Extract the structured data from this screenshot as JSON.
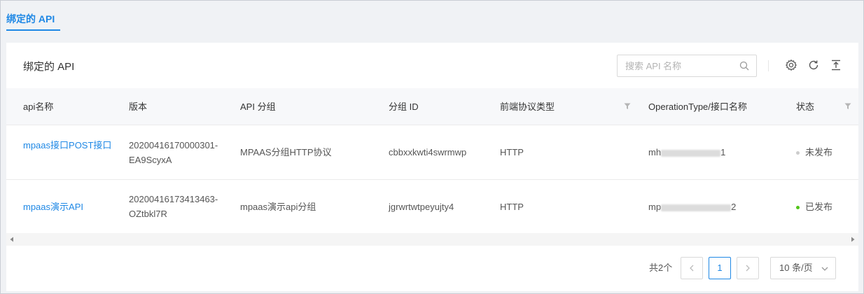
{
  "tab": {
    "label": "绑定的 API"
  },
  "card": {
    "title": "绑定的 API"
  },
  "search": {
    "placeholder": "搜索 API 名称",
    "value": ""
  },
  "toolbar": {
    "icons": [
      "settings-icon",
      "refresh-icon",
      "export-icon"
    ]
  },
  "table": {
    "columns": [
      "api名称",
      "版本",
      "API 分组",
      "分组 ID",
      "前端协议类型",
      "OperationType/接口名称",
      "状态"
    ],
    "rows": [
      {
        "name": "mpaas接口POST接口",
        "version": "20200416170000301-EA9ScyxA",
        "group": "MPAAS分组HTTP协议",
        "group_id": "cbbxxkwti4swrmwp",
        "protocol": "HTTP",
        "operation_prefix": "mh",
        "operation_suffix": "1",
        "status": "未发布",
        "status_color": "#cccccc"
      },
      {
        "name": "mpaas演示API",
        "version": "20200416173413463-OZtbkl7R",
        "group": "mpaas演示api分组",
        "group_id": "jgrwrtwtpeyujty4",
        "protocol": "HTTP",
        "operation_prefix": "mp",
        "operation_suffix": "2",
        "status": "已发布",
        "status_color": "#52c41a"
      }
    ]
  },
  "pagination": {
    "total": "共2个",
    "current": "1",
    "page_size": "10 条/页"
  },
  "colors": {
    "accent": "#1f88e5"
  }
}
